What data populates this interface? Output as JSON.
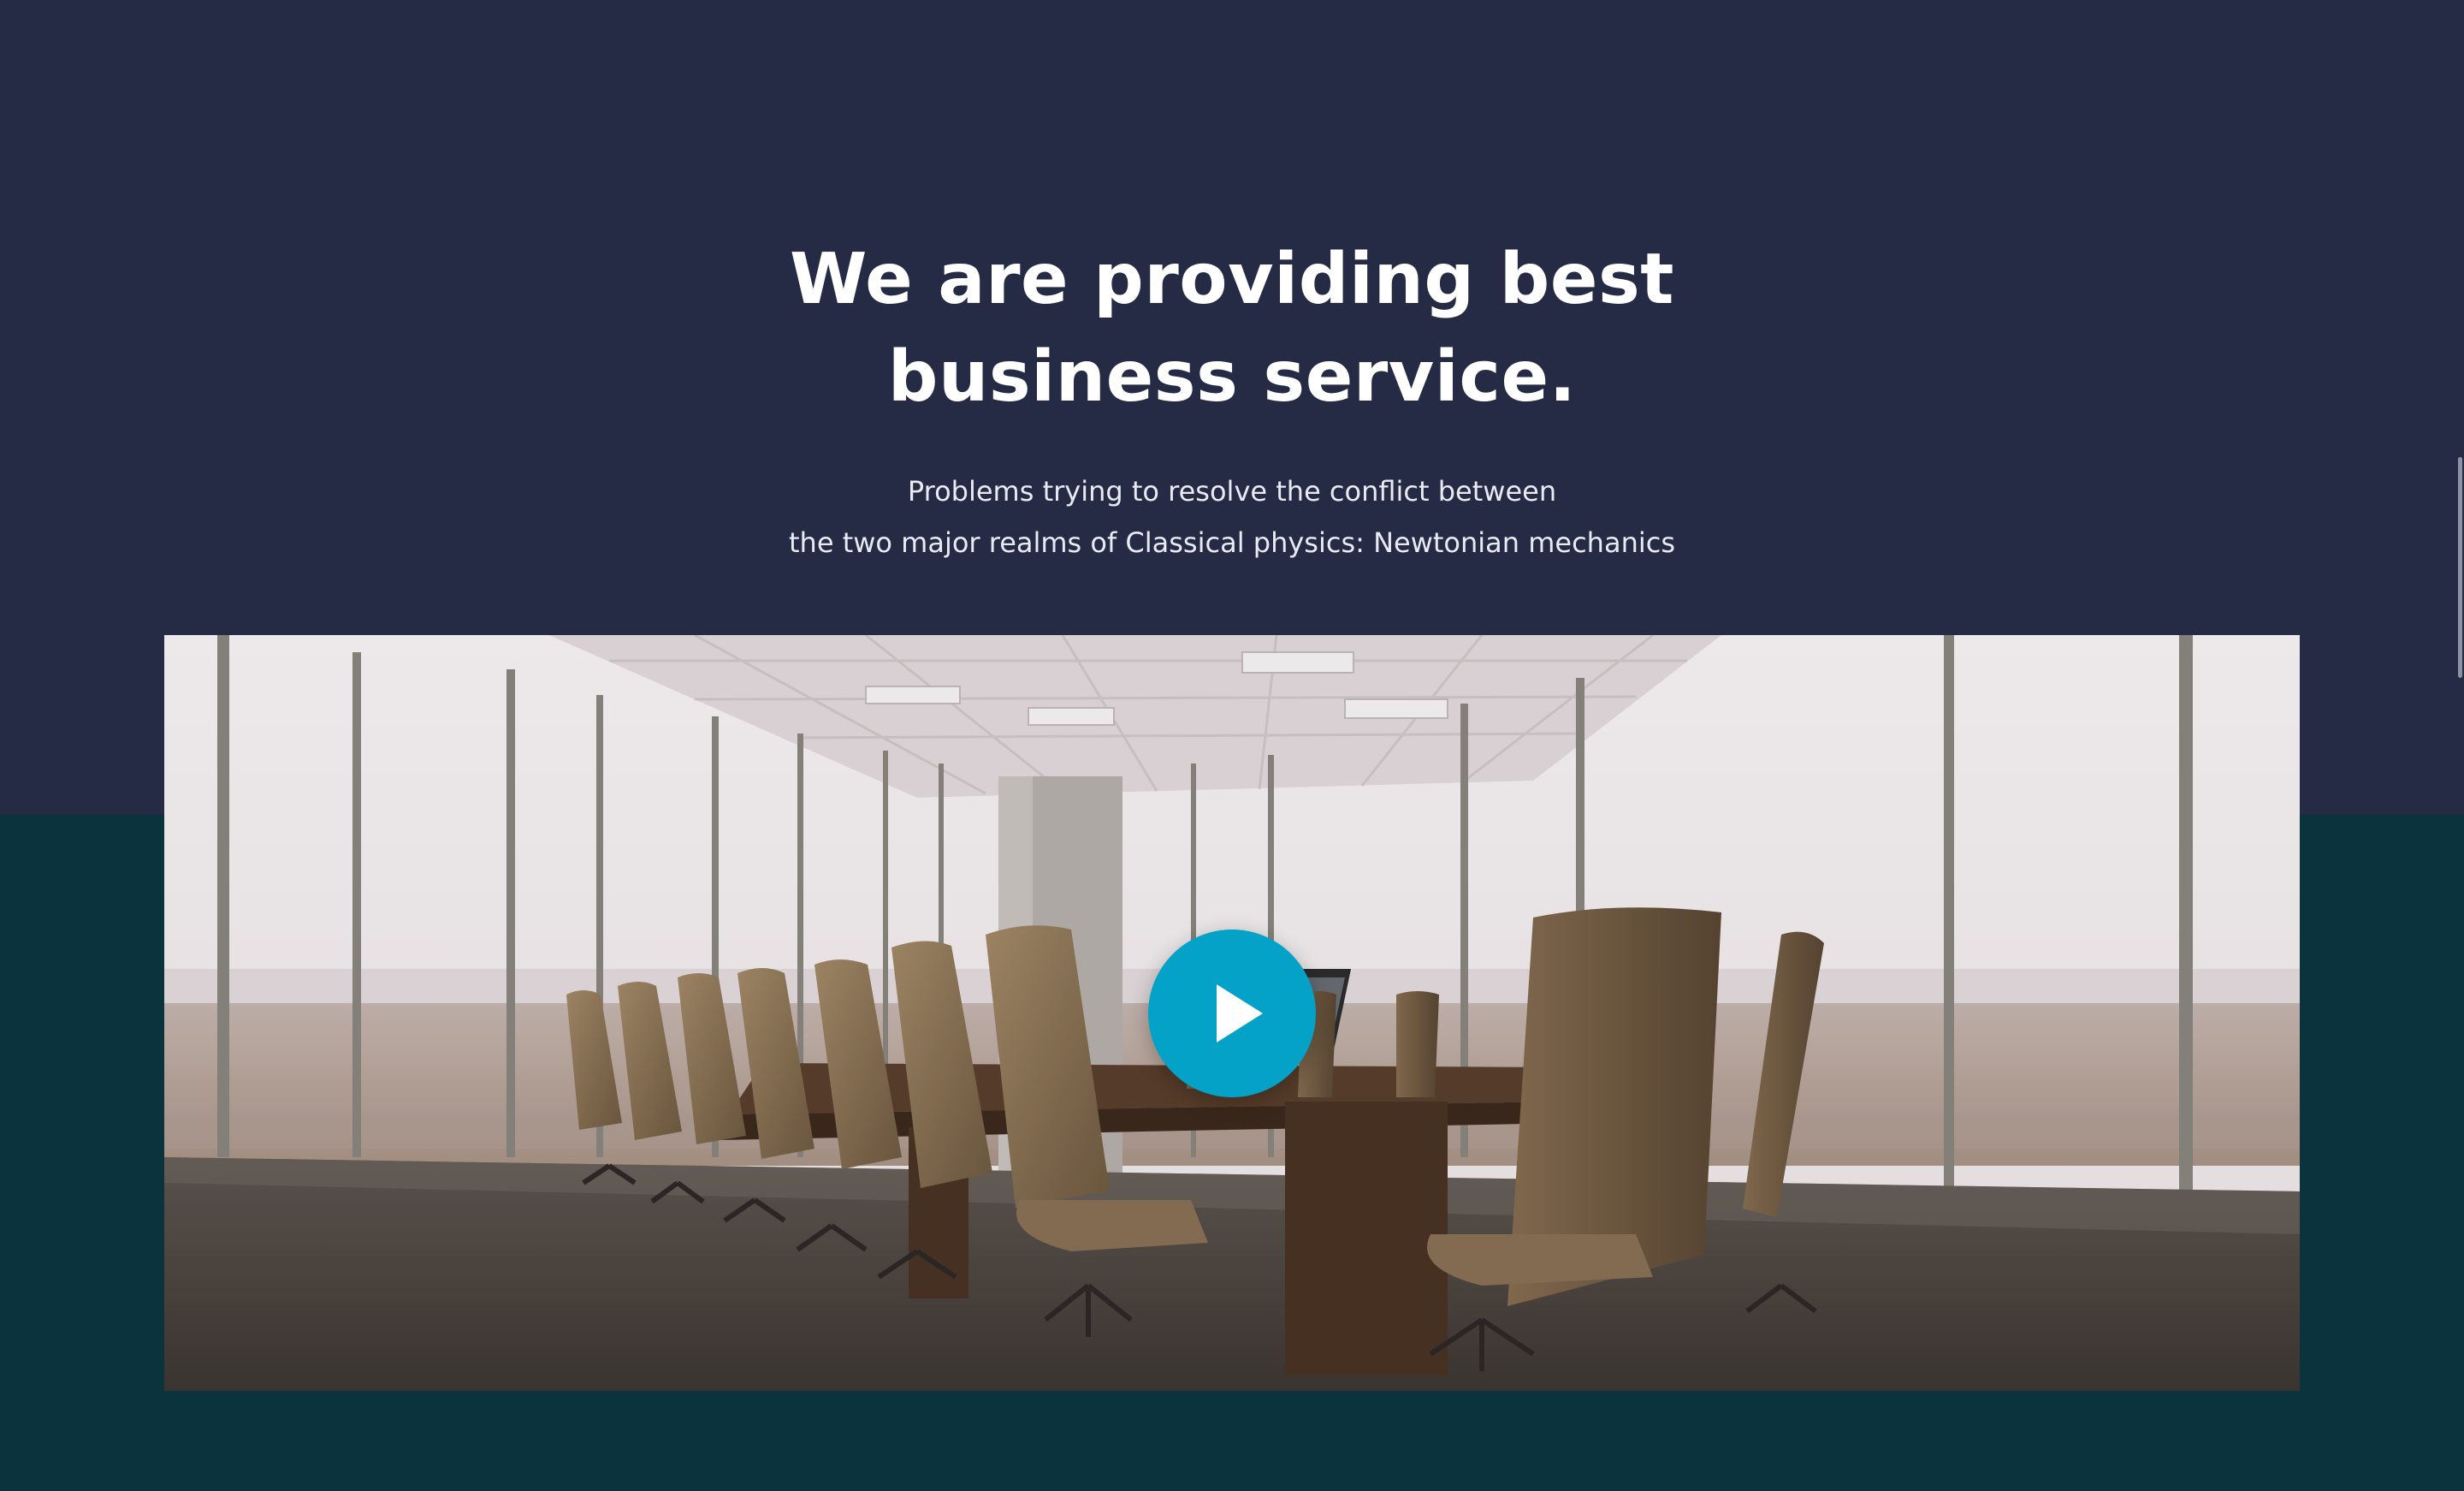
{
  "hero": {
    "headline_line1": "We are providing best",
    "headline_line2": "business service.",
    "subtext_line1": "Problems trying to resolve the conflict between",
    "subtext_line2": "the two major realms of Classical physics: Newtonian mechanics"
  },
  "video": {
    "thumbnail_subject": "conference room with office chairs",
    "play_icon": "play-icon"
  },
  "colors": {
    "top_background": "#252a45",
    "bottom_background": "#0b333d",
    "play_button": "#04a2c6",
    "text": "#ffffff"
  }
}
